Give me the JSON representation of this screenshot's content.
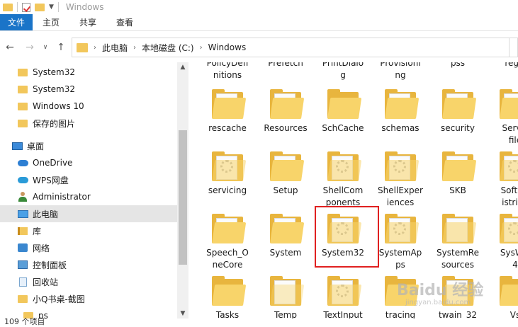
{
  "window": {
    "title": "Windows"
  },
  "ribbon": {
    "tabs": [
      "文件",
      "主页",
      "共享",
      "查看"
    ]
  },
  "address": {
    "segments": [
      "此电脑",
      "本地磁盘 (C:)",
      "Windows"
    ]
  },
  "nav": {
    "items": [
      {
        "label": "System32",
        "icon": "folder-icon"
      },
      {
        "label": "System32",
        "icon": "folder-icon"
      },
      {
        "label": "Windows 10",
        "icon": "folder-icon"
      },
      {
        "label": "保存的图片",
        "icon": "folder-icon"
      },
      {
        "label": "桌面",
        "icon": "desktop-icon"
      },
      {
        "label": "OneDrive",
        "icon": "onedrive-icon"
      },
      {
        "label": "WPS网盘",
        "icon": "wps-cloud-icon"
      },
      {
        "label": "Administrator",
        "icon": "user-icon"
      },
      {
        "label": "此电脑",
        "icon": "computer-icon"
      },
      {
        "label": "库",
        "icon": "library-icon"
      },
      {
        "label": "网络",
        "icon": "network-icon"
      },
      {
        "label": "控制面板",
        "icon": "control-panel-icon"
      },
      {
        "label": "回收站",
        "icon": "recycle-bin-icon"
      },
      {
        "label": "小Q书桌-截图",
        "icon": "folder-icon"
      },
      {
        "label": "ps",
        "icon": "folder-icon"
      }
    ]
  },
  "files": {
    "row0": [
      "PolicyDefinitions",
      "Prefetch",
      "PrintDialog",
      "Provisioning",
      "pss",
      "registration"
    ],
    "row0_display": [
      [
        "PolicyDefi",
        "nitions"
      ],
      [
        "Prefetch",
        ""
      ],
      [
        "PrintDialo",
        "g"
      ],
      [
        "Provisioni",
        "ng"
      ],
      [
        "pss",
        ""
      ],
      [
        "regis",
        ""
      ]
    ],
    "row1": [
      [
        "rescache",
        ""
      ],
      [
        "Resources",
        ""
      ],
      [
        "SchCache",
        ""
      ],
      [
        "schemas",
        ""
      ],
      [
        "security",
        ""
      ],
      [
        "Servic",
        "file"
      ]
    ],
    "row2": [
      [
        "servicing",
        ""
      ],
      [
        "Setup",
        ""
      ],
      [
        "ShellCom",
        "ponents"
      ],
      [
        "ShellExper",
        "iences"
      ],
      [
        "SKB",
        ""
      ],
      [
        "Softwa",
        "istribu"
      ]
    ],
    "row3": [
      [
        "Speech_O",
        "neCore"
      ],
      [
        "System",
        ""
      ],
      [
        "System32",
        ""
      ],
      [
        "SystemAp",
        "ps"
      ],
      [
        "SystemRe",
        "sources"
      ],
      [
        "SysWO",
        "4"
      ]
    ],
    "row4": [
      [
        "Tasks",
        ""
      ],
      [
        "Temp",
        ""
      ],
      [
        "TextInput",
        ""
      ],
      [
        "tracing",
        ""
      ],
      [
        "twain_32",
        ""
      ],
      [
        "Vs",
        ""
      ]
    ]
  },
  "status": {
    "count": "109 个项目"
  },
  "watermark": {
    "brand": "Baidu 经验",
    "url": "jingyan.baidu.com"
  }
}
